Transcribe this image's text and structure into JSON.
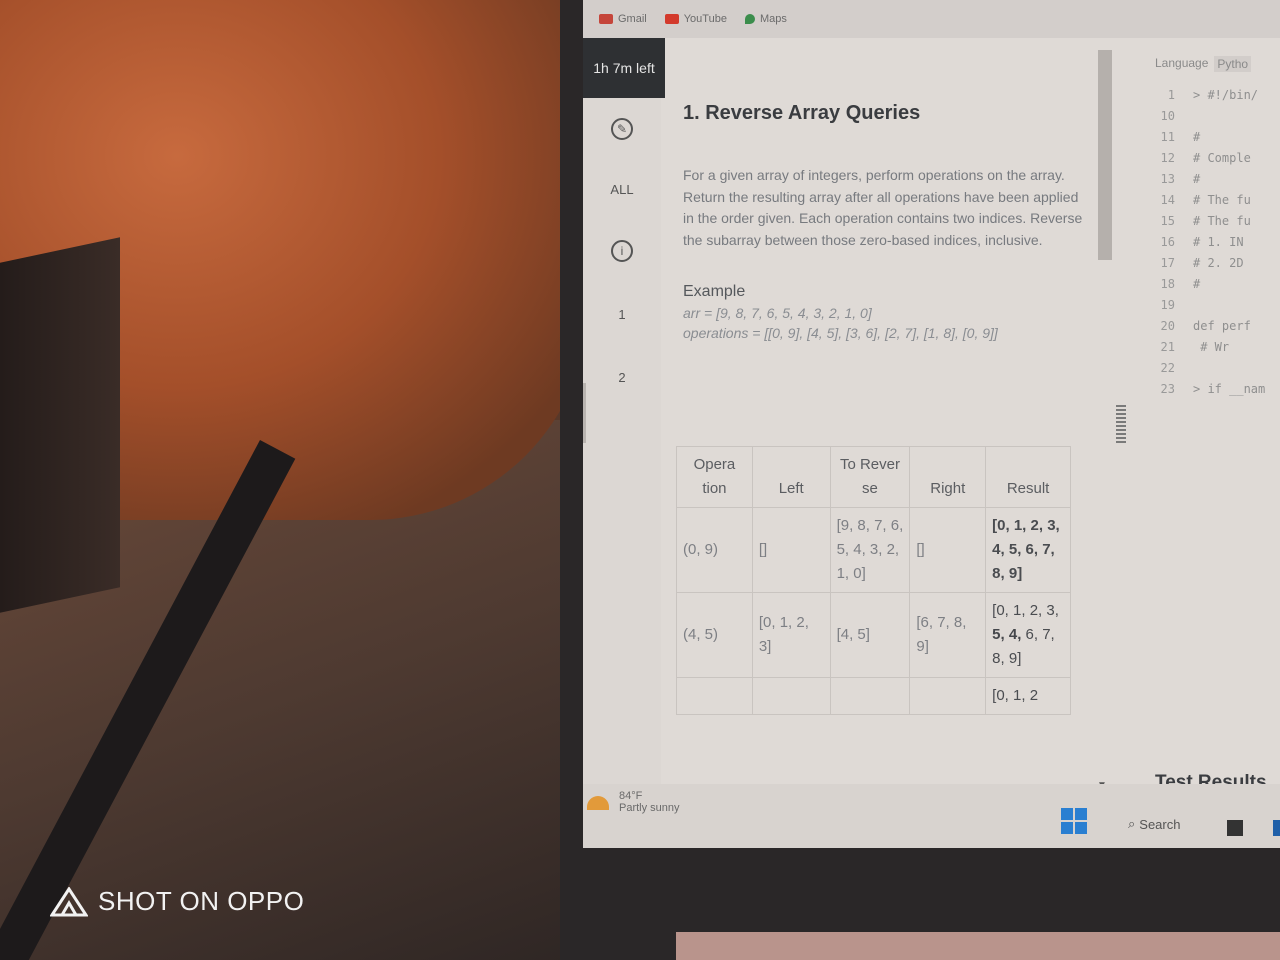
{
  "bookmarks": [
    {
      "label": "Gmail",
      "color": "#c5453a"
    },
    {
      "label": "YouTube",
      "color": "#d33a2c"
    },
    {
      "label": "Maps",
      "color": "#3b8d4c"
    }
  ],
  "timer": "1h 7m left",
  "nav": {
    "all_label": "ALL",
    "q1": "1",
    "q2": "2"
  },
  "problem": {
    "title": "1. Reverse Array Queries",
    "description": "For a given array of integers, perform operations on the array. Return the resulting array after all operations have been applied in the order given. Each operation contains two indices. Reverse the subarray between those zero-based indices, inclusive.",
    "example_title": "Example",
    "arr_line": "arr = [9, 8, 7, 6, 5, 4, 3, 2, 1, 0]",
    "ops_line": "operations = [[0, 9], [4, 5], [3, 6], [2, 7], [1, 8], [0, 9]]"
  },
  "table": {
    "headers": [
      "Opera tion",
      "Left",
      "To Rever se",
      "Right",
      "Result"
    ],
    "row1": {
      "op": "(0, 9)",
      "left": "[]",
      "reverse": "[9, 8, 7, 6, 5, 4, 3, 2, 1, 0]",
      "right": "[]",
      "result": "[0, 1, 2, 3, 4, 5, 6, 7, 8, 9]"
    },
    "row2": {
      "op": "(4, 5)",
      "left": "[0, 1, 2, 3]",
      "reverse": "[4, 5]",
      "right": "[6, 7, 8, 9]",
      "result_a": "[0, 1, 2, 3, ",
      "result_b": "5, 4,",
      "result_c": " 6, 7, 8, 9]"
    },
    "row3_partial": "[0, 1, 2"
  },
  "editor": {
    "language_label": "Language",
    "language_value": "Pytho",
    "lines": [
      {
        "n": "1",
        "code": "> #!/bin/"
      },
      {
        "n": "10",
        "code": ""
      },
      {
        "n": "11",
        "code": "#"
      },
      {
        "n": "12",
        "code": "# Comple"
      },
      {
        "n": "13",
        "code": "#"
      },
      {
        "n": "14",
        "code": "# The fu"
      },
      {
        "n": "15",
        "code": "# The fu"
      },
      {
        "n": "16",
        "code": "#  1. IN"
      },
      {
        "n": "17",
        "code": "#  2. 2D"
      },
      {
        "n": "18",
        "code": "#"
      },
      {
        "n": "19",
        "code": ""
      },
      {
        "n": "20",
        "code": "def perf"
      },
      {
        "n": "21",
        "code": "    # Wr"
      },
      {
        "n": "22",
        "code": ""
      },
      {
        "n": "23",
        "code": "> if __nam"
      }
    ]
  },
  "test_results": "Test Results",
  "taskbar": {
    "temp": "84°F",
    "condition": "Partly sunny",
    "search": "Search"
  },
  "watermark": "SHOT ON OPPO"
}
